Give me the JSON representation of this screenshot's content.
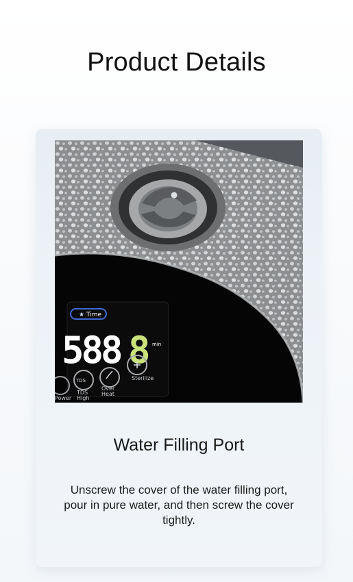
{
  "header": {
    "title": "Product Details"
  },
  "feature": {
    "title": "Water Filling Port",
    "description": "Unscrew the cover of the water filling port, pour in pure water, and then screw the cover tightly."
  },
  "display": {
    "time_badge": "Time",
    "readout": "588",
    "unit": "min",
    "buttons": [
      "Power",
      "TDS High",
      "Over Heat",
      "Sterilize"
    ],
    "tds_icon_label": "TDS"
  },
  "colors": {
    "accent_green": "#c9e27a",
    "display_white": "#ffffff",
    "time_badge_blue": "#3d6ad6"
  }
}
